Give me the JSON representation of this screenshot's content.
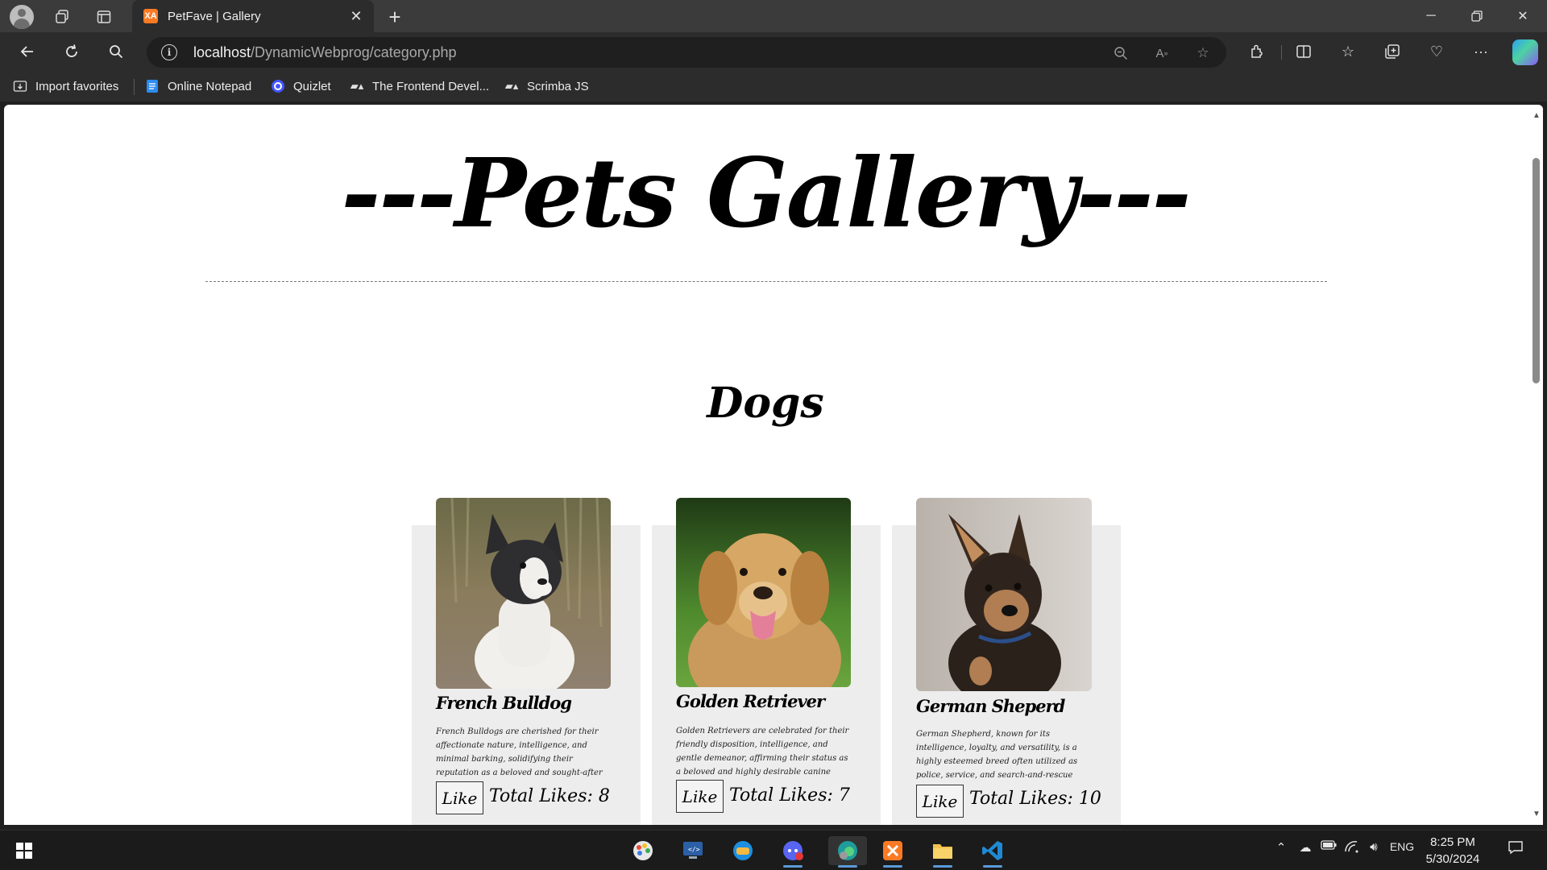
{
  "browser": {
    "tab_title": "PetFave | Gallery",
    "tab_favicon_text": "XA",
    "url_host": "localhost",
    "url_path": "/DynamicWebprog/category.php"
  },
  "favorites": {
    "items": [
      {
        "label": "Import favorites",
        "icon": "import-icon"
      },
      {
        "label": "Online Notepad",
        "icon": "notepad-icon"
      },
      {
        "label": "Quizlet",
        "icon": "quizlet-icon"
      },
      {
        "label": "The Frontend Devel...",
        "icon": "scrimba-icon"
      },
      {
        "label": "Scrimba JS",
        "icon": "scrimba-icon"
      }
    ]
  },
  "page": {
    "gallery_title": "---Pets Gallery---",
    "category": "Dogs",
    "pets": [
      {
        "name": "French Bulldog",
        "description": "French Bulldogs are cherished for their affectionate nature, intelligence, and minimal barking, solidifying their reputation as a beloved and sought-after dog breed.",
        "like_label": "Like",
        "likes_text": "Total Likes: 8",
        "likes": 8
      },
      {
        "name": "Golden Retriever",
        "description": "Golden Retrievers are celebrated for their friendly disposition, intelligence, and gentle demeanor, affirming their status as a beloved and highly desirable canine companion.",
        "like_label": "Like",
        "likes_text": "Total Likes: 7",
        "likes": 7
      },
      {
        "name": "German Sheperd",
        "description": "German Shepherd, known for its intelligence, loyalty, and versatility, is a highly esteemed breed often utilized as police, service, and search-and-rescue dogs.",
        "like_label": "Like",
        "likes_text": "Total Likes: 10",
        "likes": 10
      }
    ]
  },
  "taskbar": {
    "language": "ENG",
    "time": "8:25 PM",
    "date": "5/30/2024"
  },
  "colors": {
    "chrome_bg": "#3b3b3b",
    "tab_bg": "#2c2c2c",
    "omnibox_bg": "#1f1f1f",
    "card_bg": "#ededed",
    "accent": "#fb7a24"
  }
}
